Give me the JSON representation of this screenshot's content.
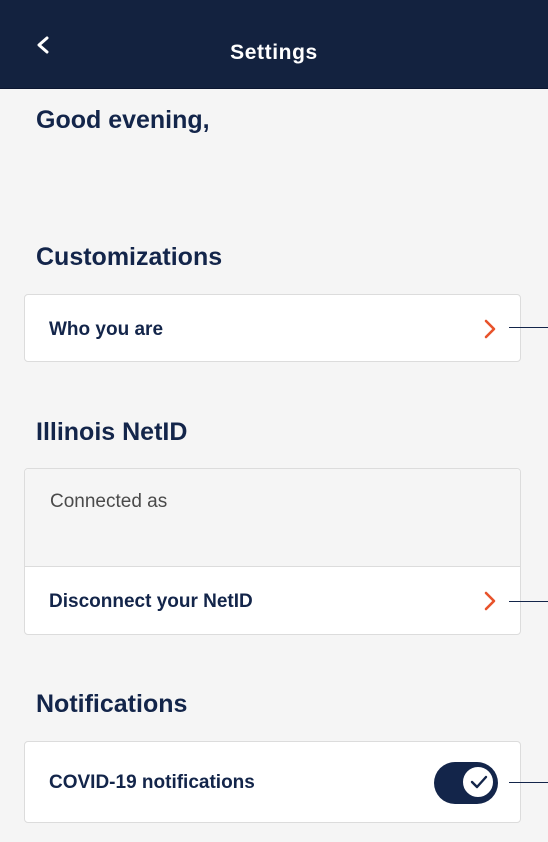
{
  "header": {
    "title": "Settings",
    "back_icon": "chevron-left-icon"
  },
  "greeting": "Good evening,",
  "customizations": {
    "title": "Customizations",
    "items": [
      {
        "label": "Who you are",
        "icon": "chevron-right-icon"
      }
    ]
  },
  "netid": {
    "title": "Illinois NetID",
    "connected_label": "Connected as",
    "disconnect_label": "Disconnect your NetID"
  },
  "notifications": {
    "title": "Notifications",
    "items": [
      {
        "label": "COVID-19 notifications",
        "enabled": true
      }
    ]
  },
  "colors": {
    "header_bg": "#13223f",
    "text_primary": "#13254a",
    "accent_chevron": "#e8522b",
    "background": "#f5f5f5"
  }
}
